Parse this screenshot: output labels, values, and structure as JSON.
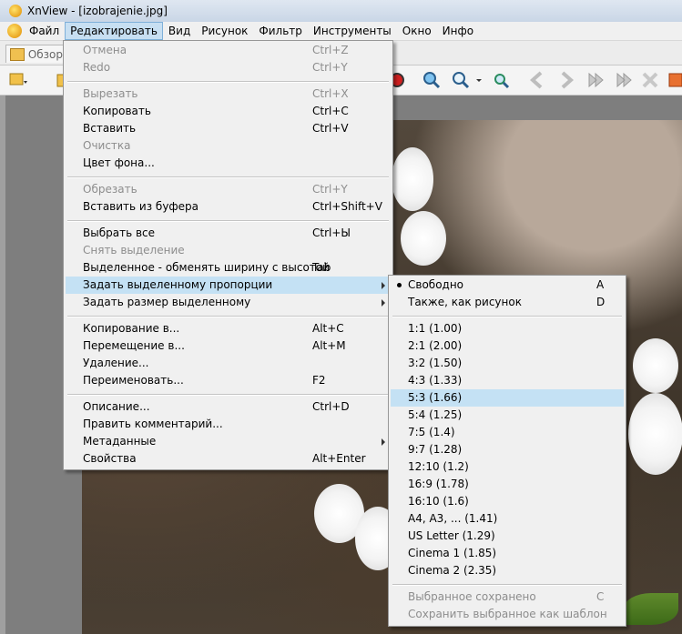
{
  "window": {
    "title": "XnView - [izobrajenie.jpg]"
  },
  "menubar": {
    "items": [
      "Файл",
      "Редактировать",
      "Вид",
      "Рисунок",
      "Фильтр",
      "Инструменты",
      "Окно",
      "Инфо"
    ],
    "active": "Редактировать"
  },
  "tab": {
    "label": "Обзор"
  },
  "edit_menu": {
    "items": [
      {
        "label": "Отмена",
        "shortcut": "Ctrl+Z",
        "disabled": true
      },
      {
        "label": "Redo",
        "shortcut": "Ctrl+Y",
        "disabled": true
      },
      {
        "label": "Вырезать",
        "shortcut": "Ctrl+X",
        "disabled": true
      },
      {
        "label": "Копировать",
        "shortcut": "Ctrl+C"
      },
      {
        "label": "Вставить",
        "shortcut": "Ctrl+V"
      },
      {
        "label": "Очистка",
        "shortcut": "",
        "disabled": true
      },
      {
        "label": "Цвет фона...",
        "shortcut": ""
      },
      {
        "label": "Обрезать",
        "shortcut": "Ctrl+Y",
        "disabled": true
      },
      {
        "label": "Вставить из буфера",
        "shortcut": "Ctrl+Shift+V"
      },
      {
        "label": "Выбрать все",
        "shortcut": "Ctrl+Ы"
      },
      {
        "label": "Снять выделение",
        "shortcut": "",
        "disabled": true
      },
      {
        "label": "Выделенное - обменять ширину с высотой",
        "shortcut": "Tab"
      },
      {
        "label": "Задать выделенному пропорции",
        "shortcut": "",
        "submenu": true,
        "highlighted": true
      },
      {
        "label": "Задать размер выделенному",
        "shortcut": "",
        "submenu": true
      },
      {
        "label": "Копирование в...",
        "shortcut": "Alt+C"
      },
      {
        "label": "Перемещение в...",
        "shortcut": "Alt+M"
      },
      {
        "label": "Удаление...",
        "shortcut": ""
      },
      {
        "label": "Переименовать...",
        "shortcut": "F2"
      },
      {
        "label": "Описание...",
        "shortcut": "Ctrl+D"
      },
      {
        "label": "Править комментарий...",
        "shortcut": ""
      },
      {
        "label": "Метаданные",
        "shortcut": "",
        "submenu": true
      },
      {
        "label": "Свойства",
        "shortcut": "Alt+Enter"
      }
    ]
  },
  "ratio_menu": {
    "items": [
      {
        "label": "Свободно",
        "shortcut": "A",
        "checked": true
      },
      {
        "label": "Также, как рисунок",
        "shortcut": "D"
      },
      {
        "label": "1:1 (1.00)"
      },
      {
        "label": "2:1 (2.00)"
      },
      {
        "label": "3:2 (1.50)"
      },
      {
        "label": "4:3 (1.33)"
      },
      {
        "label": "5:3 (1.66)",
        "highlighted": true
      },
      {
        "label": "5:4 (1.25)"
      },
      {
        "label": "7:5 (1.4)"
      },
      {
        "label": "9:7 (1.28)"
      },
      {
        "label": "12:10 (1.2)"
      },
      {
        "label": "16:9 (1.78)"
      },
      {
        "label": "16:10 (1.6)"
      },
      {
        "label": "A4, A3, ... (1.41)"
      },
      {
        "label": "US Letter (1.29)"
      },
      {
        "label": "Cinema 1 (1.85)"
      },
      {
        "label": "Cinema 2 (2.35)"
      },
      {
        "label": "Выбранное сохранено",
        "shortcut": "C",
        "disabled": true
      },
      {
        "label": "Сохранить выбранное как шаблон",
        "disabled": true
      }
    ]
  },
  "colors": {
    "highlight": "#c4e1f4",
    "menu_bg": "#f0f0f0",
    "disabled_text": "#8d8d8d"
  }
}
